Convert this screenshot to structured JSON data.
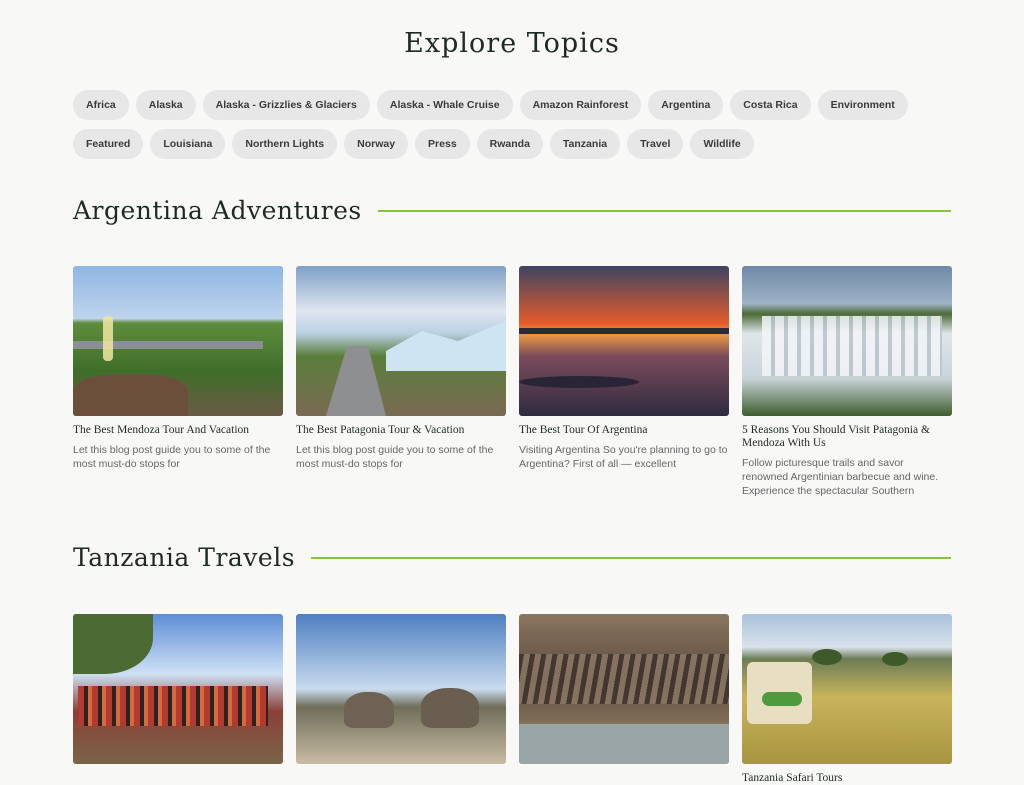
{
  "page_title": "Explore Topics",
  "topics": [
    "Africa",
    "Alaska",
    "Alaska - Grizzlies & Glaciers",
    "Alaska - Whale Cruise",
    "Amazon Rainforest",
    "Argentina",
    "Costa Rica",
    "Environment",
    "Featured",
    "Louisiana",
    "Northern Lights",
    "Norway",
    "Press",
    "Rwanda",
    "Tanzania",
    "Travel",
    "Wildlife"
  ],
  "sections": [
    {
      "title": "Argentina Adventures",
      "posts": [
        {
          "title": "The Best Mendoza Tour And Vacation",
          "excerpt": "Let this blog post guide you to some of the most must-do stops for"
        },
        {
          "title": "The Best Patagonia Tour & Vacation",
          "excerpt": "Let this blog post guide you to some of the most must-do stops for"
        },
        {
          "title": "The Best Tour Of Argentina",
          "excerpt": "Visiting Argentina So you're planning to go to Argentina? First of all — excellent"
        },
        {
          "title": "5 Reasons You Should Visit Patagonia & Mendoza With Us",
          "excerpt": "Follow picturesque trails and savor renowned Argentinian barbecue and wine. Experience the spectacular Southern"
        }
      ]
    },
    {
      "title": "Tanzania Travels",
      "posts": [
        {
          "title": "",
          "excerpt": ""
        },
        {
          "title": "",
          "excerpt": ""
        },
        {
          "title": "",
          "excerpt": ""
        },
        {
          "title": "Tanzania Safari Tours",
          "excerpt": ""
        }
      ]
    }
  ],
  "colors": {
    "accent_rule": "#86c440",
    "chip_bg": "#e7e7e7",
    "page_bg": "#f8f8f7"
  }
}
